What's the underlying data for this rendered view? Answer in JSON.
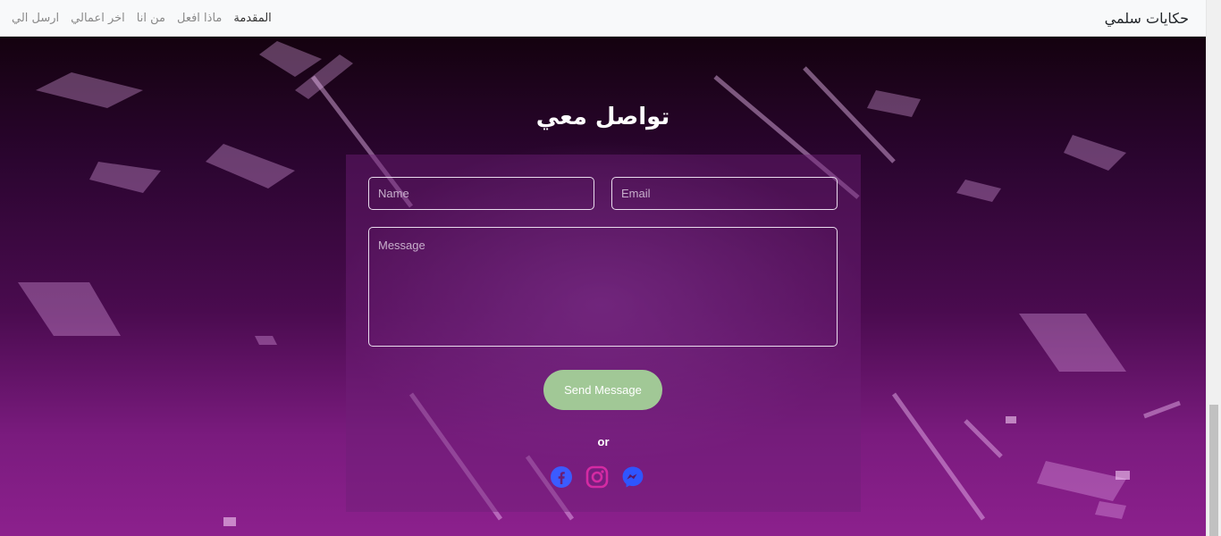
{
  "navbar": {
    "brand": "حكايات سلمي",
    "links": [
      {
        "label": "المقدمة"
      },
      {
        "label": "ماذا افعل"
      },
      {
        "label": "من انا"
      },
      {
        "label": "اخر اعمالي"
      },
      {
        "label": "ارسل الي"
      }
    ]
  },
  "contact": {
    "title": "تواصل معي",
    "name_placeholder": "Name",
    "email_placeholder": "Email",
    "message_placeholder": "Message",
    "send_label": "Send Message",
    "or_label": "or"
  },
  "social": {
    "icons": [
      "facebook-icon",
      "instagram-icon",
      "messenger-icon"
    ]
  },
  "colors": {
    "send_button": "#a1c896",
    "facebook": "#3b5bff",
    "instagram": "#d42aa3",
    "messenger": "#2f55ff"
  }
}
